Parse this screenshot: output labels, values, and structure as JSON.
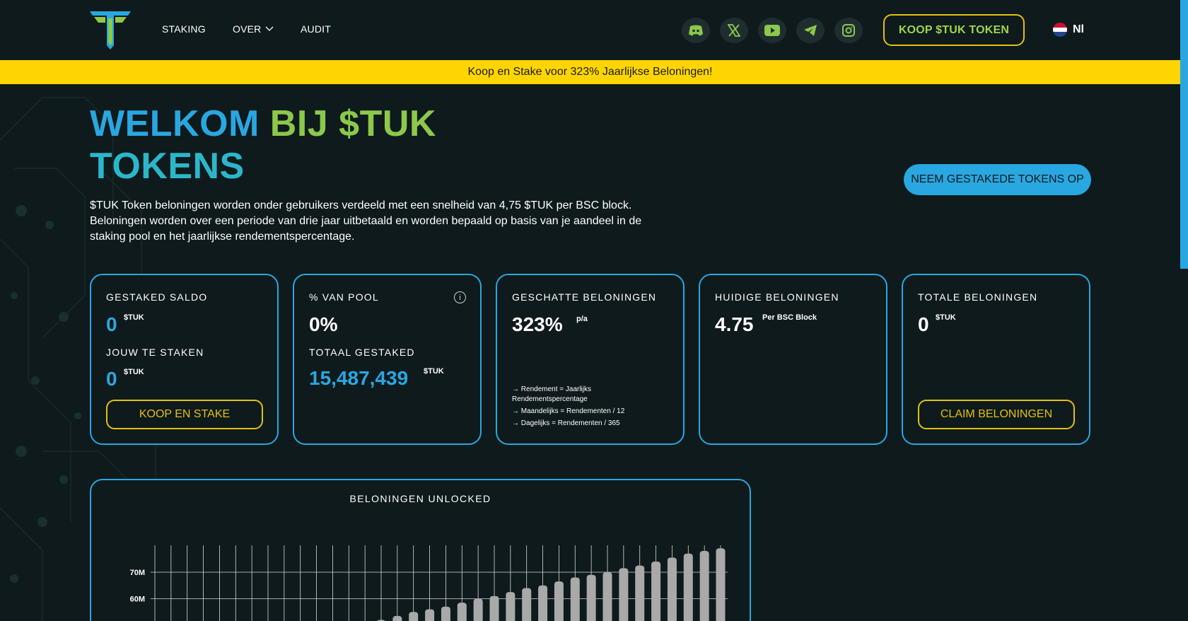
{
  "nav": {
    "staking": "STAKING",
    "over": "OVER",
    "audit": "AUDIT"
  },
  "social_icons": [
    "discord-icon",
    "x-icon",
    "youtube-icon",
    "telegram-icon",
    "instagram-icon"
  ],
  "header": {
    "buy_token": "KOOP $TUK TOKEN",
    "language": "Nl"
  },
  "banner": "Koop en Stake voor 323% Jaarlijkse Beloningen!",
  "hero": {
    "title_part1": "WELKOM",
    "title_part2": "BIJ $TUK",
    "title_line2": "TOKENS",
    "text": "$TUK Token beloningen worden onder gebruikers verdeeld met een snelheid van 4,75 $TUK per BSC block. Beloningen worden over een periode van drie jaar uitbetaald en worden bepaald op basis van je aandeel in de staking pool en het jaarlijkse rendementspercentage.",
    "unstake_button": "NEEM GESTAKEDE TOKENS OP"
  },
  "cards": {
    "staked": {
      "label": "GESTAKED SALDO",
      "value": "0",
      "unit": "$TUK",
      "label2": "JOUW TE STAKEN",
      "value2": "0",
      "unit2": "$TUK",
      "button": "KOOP EN STAKE"
    },
    "pool": {
      "label": "% VAN POOL",
      "value": "0%",
      "label2": "TOTAAL GESTAKED",
      "value2": "15,487,439",
      "unit2": "$TUK"
    },
    "estimated": {
      "label": "GESCHATTE BELONINGEN",
      "value": "323%",
      "unit": "p/a",
      "note1": "Rendement = Jaarlijks Rendementspercentage",
      "note2": "Maandelijks = Rendementen / 12",
      "note3": "Dagelijks = Rendementen / 365"
    },
    "current": {
      "label": "HUIDIGE BELONINGEN",
      "value": "4.75",
      "unit": "Per BSC Block"
    },
    "total": {
      "label": "TOTALE BELONINGEN",
      "value": "0",
      "unit": "$TUK",
      "button": "CLAIM BELONINGEN"
    }
  },
  "colors": {
    "accent_blue": "#29a7e1",
    "accent_green": "#8cc84b",
    "accent_yellow": "#e2c20c",
    "banner_yellow": "#ffd500",
    "background": "#0f1a1c"
  },
  "chart_data": {
    "type": "bar",
    "title": "BELONINGEN UNLOCKED",
    "y_tick_labels": [
      "70M",
      "60M"
    ],
    "values": [
      null,
      null,
      null,
      null,
      null,
      null,
      null,
      null,
      null,
      null,
      null,
      null,
      null,
      51,
      52,
      53.5,
      55,
      56,
      57,
      58.5,
      60,
      61,
      62.5,
      64,
      65,
      66.5,
      68,
      69,
      70,
      71.5,
      72.5,
      74,
      75.5,
      77,
      78,
      79
    ]
  }
}
